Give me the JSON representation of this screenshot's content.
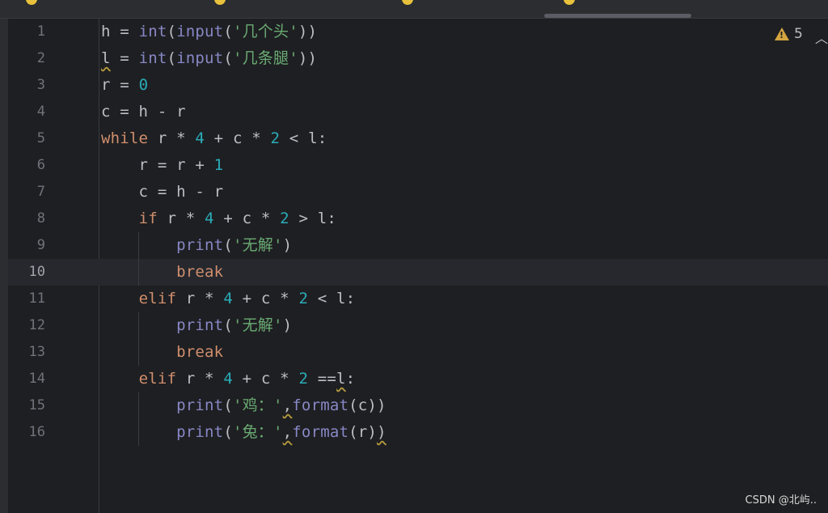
{
  "editor": {
    "inspection_count": "5",
    "current_line": "10",
    "lines": [
      {
        "no": "1"
      },
      {
        "no": "2"
      },
      {
        "no": "3"
      },
      {
        "no": "4"
      },
      {
        "no": "5"
      },
      {
        "no": "6"
      },
      {
        "no": "7"
      },
      {
        "no": "8"
      },
      {
        "no": "9"
      },
      {
        "no": "10"
      },
      {
        "no": "11"
      },
      {
        "no": "12"
      },
      {
        "no": "13"
      },
      {
        "no": "14"
      },
      {
        "no": "15"
      },
      {
        "no": "16"
      }
    ],
    "code": {
      "l1": {
        "a": "h = ",
        "fn1": "int",
        "p1": "(",
        "fn2": "input",
        "p2": "(",
        "s": "'几个头'",
        "p3": "))"
      },
      "l2": {
        "v": "l",
        "a": " = ",
        "fn1": "int",
        "p1": "(",
        "fn2": "input",
        "p2": "(",
        "s": "'几条腿'",
        "p3": "))"
      },
      "l3": {
        "a": "r = ",
        "n": "0"
      },
      "l4": {
        "a": "c = h - r"
      },
      "l5": {
        "k": "while",
        "a": " r * ",
        "n1": "4",
        "b": " + c * ",
        "n2": "2",
        "c": " < l:"
      },
      "l6": {
        "a": "    r = r + ",
        "n": "1"
      },
      "l7": {
        "a": "    c = h - r"
      },
      "l8": {
        "i": "    ",
        "k": "if",
        "a": " r * ",
        "n1": "4",
        "b": " + c * ",
        "n2": "2",
        "c": " > l:"
      },
      "l9": {
        "i": "        ",
        "fn": "print",
        "p1": "(",
        "s": "'无解'",
        "p2": ")"
      },
      "l10": {
        "i": "        ",
        "k": "break"
      },
      "l11": {
        "i": "    ",
        "k": "elif",
        "a": " r * ",
        "n1": "4",
        "b": " + c * ",
        "n2": "2",
        "c": " < l:"
      },
      "l12": {
        "i": "        ",
        "fn": "print",
        "p1": "(",
        "s": "'无解'",
        "p2": ")"
      },
      "l13": {
        "i": "        ",
        "k": "break"
      },
      "l14": {
        "i": "    ",
        "k": "elif",
        "a": " r * ",
        "n1": "4",
        "b": " + c * ",
        "n2": "2",
        "c": " ==",
        "v": "l",
        "d": ":"
      },
      "l15": {
        "i": "        ",
        "fn1": "print",
        "p1": "(",
        "s": "'鸡：'",
        "cm": ",",
        "fn2": "format",
        "p2": "(c))"
      },
      "l16": {
        "i": "        ",
        "fn1": "print",
        "p1": "(",
        "s": "'兔：'",
        "cm": ",",
        "fn2": "format",
        "p2": "(r)",
        "p3": ")"
      }
    }
  },
  "watermark": "CSDN @北屿.."
}
